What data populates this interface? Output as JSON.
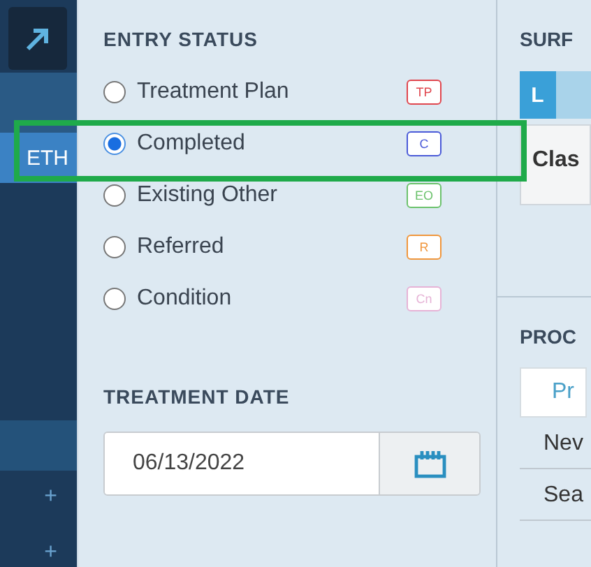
{
  "sidebar": {
    "tab": {
      "label": "ETH",
      "selected": true
    },
    "add_buttons": [
      "+",
      "+"
    ]
  },
  "entry_status": {
    "title": "ENTRY STATUS",
    "options": [
      {
        "label": "Treatment Plan",
        "selected": false,
        "badge": "TP",
        "color": "#e0464e"
      },
      {
        "label": "Completed",
        "selected": true,
        "badge": "C",
        "color": "#4a5ad8"
      },
      {
        "label": "Existing Other",
        "selected": false,
        "badge": "EO",
        "color": "#6cc26c"
      },
      {
        "label": "Referred",
        "selected": false,
        "badge": "R",
        "color": "#f0963c"
      },
      {
        "label": "Condition",
        "selected": false,
        "badge": "Cn",
        "color": "#e6b3d6"
      }
    ]
  },
  "treatment_date": {
    "title": "TREATMENT DATE",
    "value": "06/13/2022"
  },
  "surfaces": {
    "title": "SURF",
    "tabs": [
      {
        "label": "L",
        "selected": true
      },
      {
        "selected": false
      }
    ],
    "card": "Clas"
  },
  "procedures": {
    "title": "PROC",
    "button": "Pr",
    "rows": [
      "Nev",
      "Sea"
    ]
  },
  "annotation": {
    "kind": "highlight",
    "color": "#1faa4a"
  }
}
